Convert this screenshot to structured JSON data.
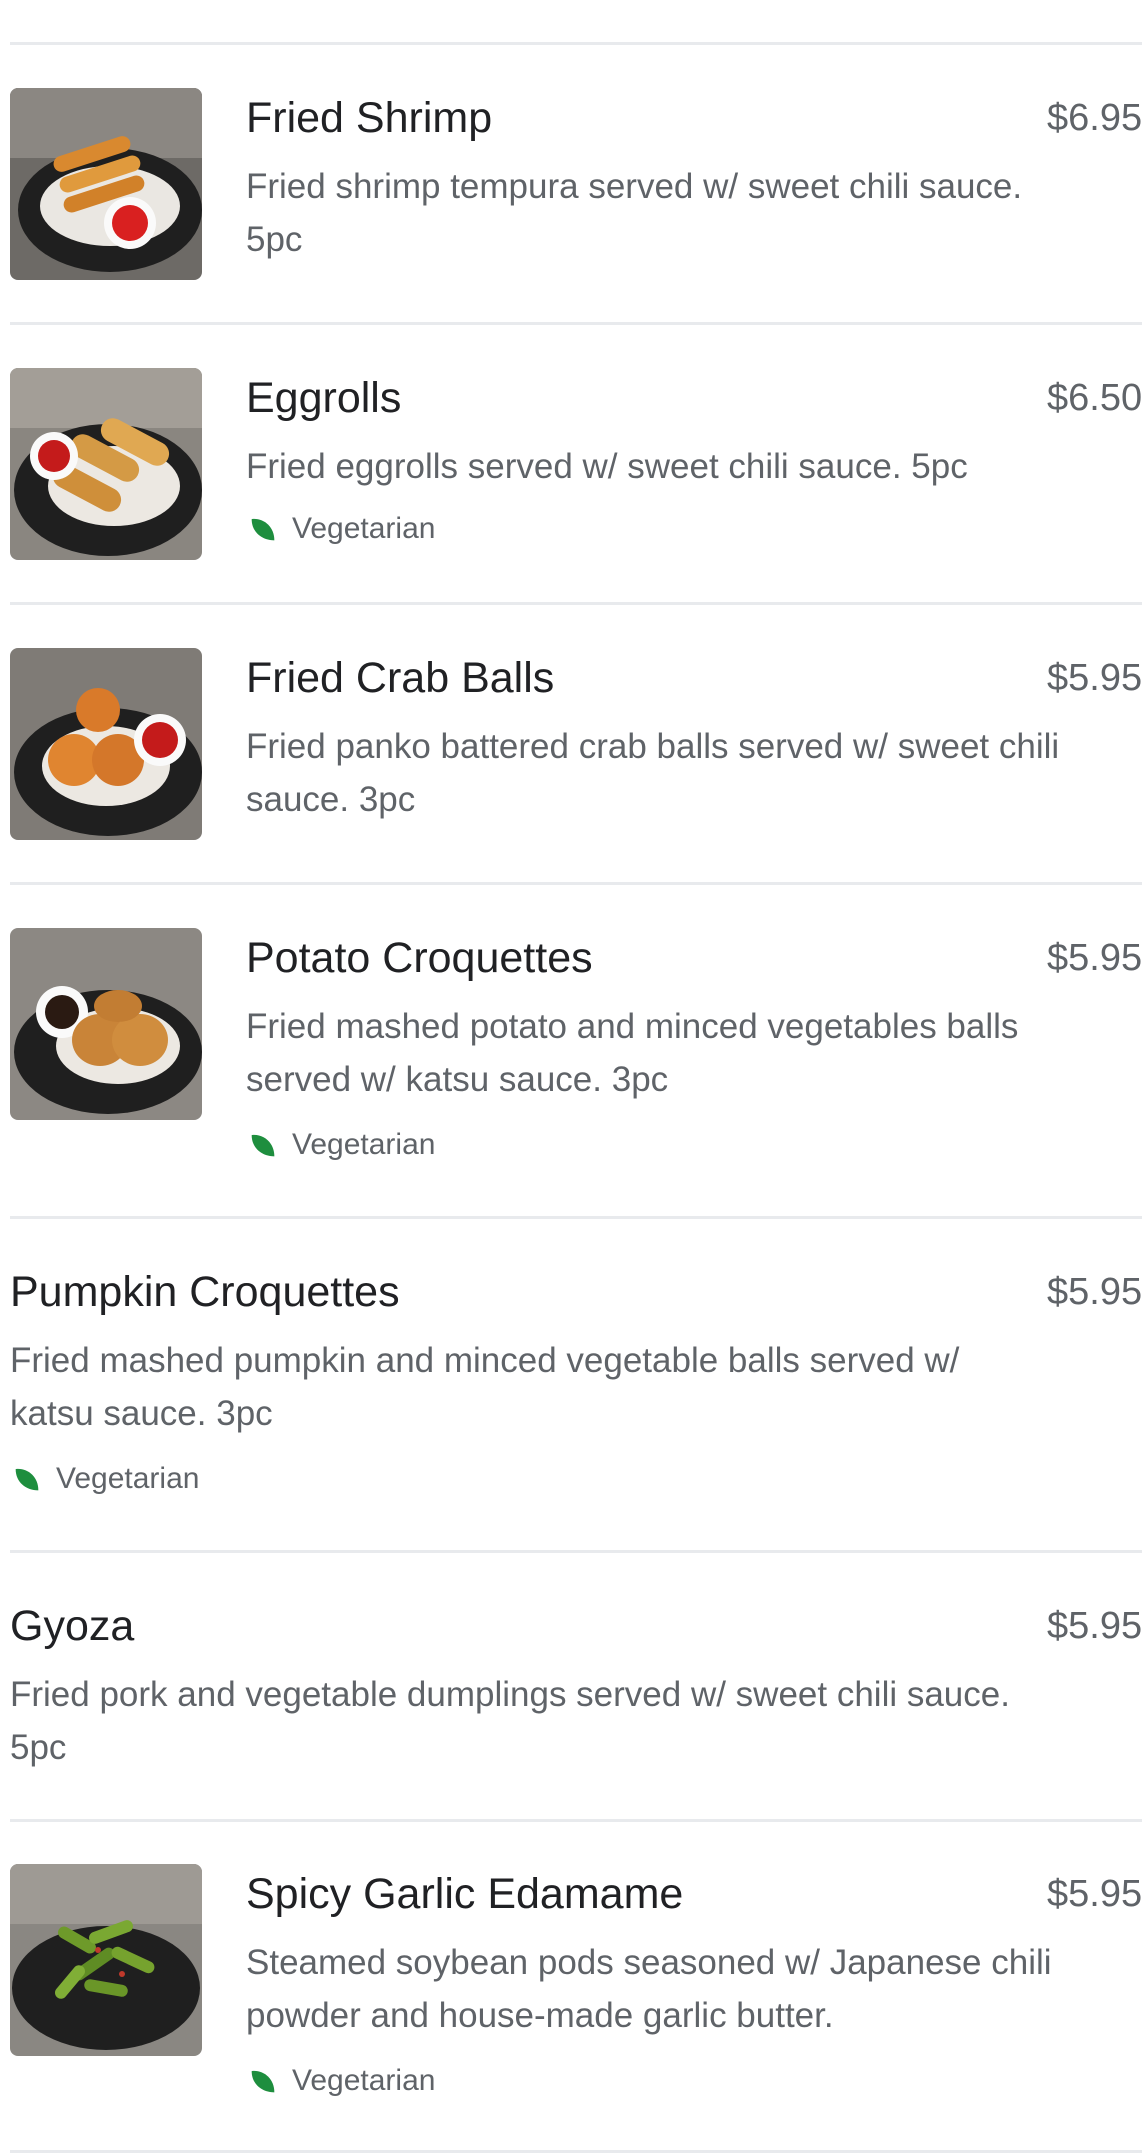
{
  "menu": {
    "items": [
      {
        "name": "Fried Shrimp",
        "price": "$6.95",
        "description": "Fried shrimp tempura served w/ sweet chili sauce.\n5pc",
        "photo": "fried-shrimp-photo"
      },
      {
        "name": "Eggrolls",
        "price": "$6.50",
        "description": "Fried eggrolls served w/ sweet chili sauce. 5pc",
        "tag": "Vegetarian",
        "photo": "eggrolls-photo"
      },
      {
        "name": "Fried Crab Balls",
        "price": "$5.95",
        "description": "Fried panko battered crab balls served w/ sweet chili\nsauce. 3pc",
        "photo": "crab-balls-photo"
      },
      {
        "name": "Potato Croquettes",
        "price": "$5.95",
        "description": "Fried mashed potato and minced vegetables balls\nserved w/ katsu sauce. 3pc",
        "tag": "Vegetarian",
        "photo": "potato-croquettes-photo"
      },
      {
        "name": "Pumpkin Croquettes",
        "price": "$5.95",
        "description": "Fried mashed pumpkin and minced vegetable balls served w/\nkatsu sauce. 3pc",
        "tag": "Vegetarian"
      },
      {
        "name": "Gyoza",
        "price": "$5.95",
        "description": "Fried pork and vegetable dumplings served w/ sweet chili sauce.\n5pc"
      },
      {
        "name": "Spicy Garlic Edamame",
        "price": "$5.95",
        "description": "Steamed soybean pods seasoned w/ Japanese chili\npowder and house-made garlic butter.",
        "tag": "Vegetarian",
        "photo": "edamame-photo"
      }
    ]
  },
  "colors": {
    "divider": "#e8eaed",
    "leaf": "#1e8e3e",
    "plate": "#1f1f1f",
    "fried": "#d9892f"
  }
}
